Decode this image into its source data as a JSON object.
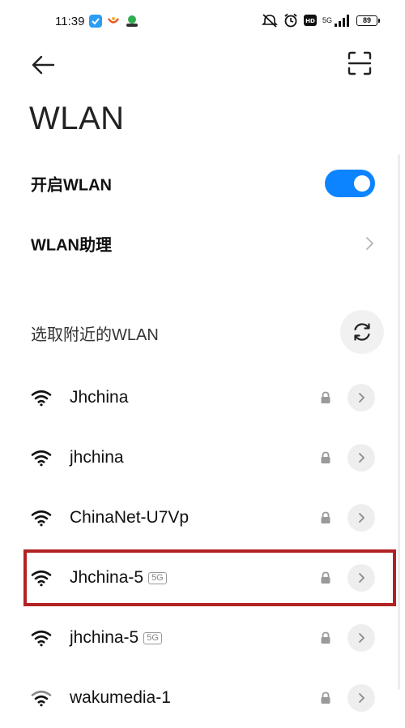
{
  "status_bar": {
    "time": "11:39",
    "network": "5G",
    "battery": "89"
  },
  "header": {
    "title": "WLAN"
  },
  "settings": {
    "wlan_toggle_label": "开启WLAN",
    "wlan_enabled": true,
    "assistant_label": "WLAN助理"
  },
  "nearby": {
    "title": "选取附近的WLAN"
  },
  "networks": [
    {
      "name": "Jhchina",
      "band": "",
      "locked": true
    },
    {
      "name": "jhchina",
      "band": "",
      "locked": true
    },
    {
      "name": "ChinaNet-U7Vp",
      "band": "",
      "locked": true
    },
    {
      "name": "Jhchina-5",
      "band": "5G",
      "locked": true
    },
    {
      "name": "jhchina-5",
      "band": "5G",
      "locked": true
    },
    {
      "name": "wakumedia-1",
      "band": "",
      "locked": true
    }
  ],
  "colors": {
    "accent": "#0d84ff",
    "highlight": "#b22222"
  },
  "icons": {
    "back": "arrow-left-icon",
    "scan": "scan-icon",
    "refresh": "refresh-icon",
    "wifi": "wifi-icon",
    "lock": "lock-icon",
    "detail": "chevron-right-icon"
  }
}
